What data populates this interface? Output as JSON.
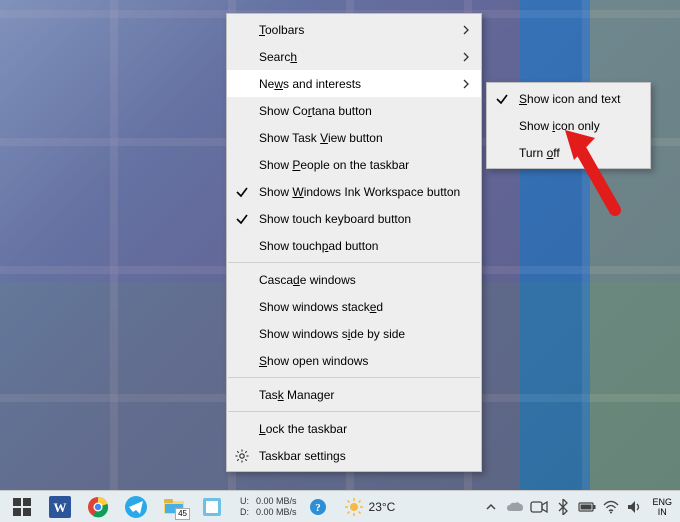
{
  "contextMenu": {
    "items": [
      {
        "label_html": "<span class='u'>T</span>oolbars",
        "submenu": true
      },
      {
        "label_html": "Searc<span class='u'>h</span>",
        "submenu": true
      },
      {
        "label_html": "Ne<span class='u'>w</span>s and interests",
        "submenu": true,
        "hovered": true
      },
      {
        "label_html": "Show Co<span class='u'>r</span>tana button"
      },
      {
        "label_html": "Show Task <span class='u'>V</span>iew button"
      },
      {
        "label_html": "Show <span class='u'>P</span>eople on the taskbar"
      },
      {
        "label_html": "Show <span class='u'>W</span>indows Ink Workspace button",
        "checked": true
      },
      {
        "label_html": "Show touch keyboard button",
        "checked": true
      },
      {
        "label_html": "Show touch<span class='u'>p</span>ad button"
      },
      {
        "separator": true
      },
      {
        "label_html": "Casca<span class='u'>d</span>e windows"
      },
      {
        "label_html": "Show windows stack<span class='u'>e</span>d"
      },
      {
        "label_html": "Show windows s<span class='u'>i</span>de by side"
      },
      {
        "label_html": "<span class='u'>S</span>how open windows"
      },
      {
        "separator": true
      },
      {
        "label_html": "Tas<span class='u'>k</span> Manager"
      },
      {
        "separator": true
      },
      {
        "label_html": "<span class='u'>L</span>ock the taskbar"
      },
      {
        "label_html": "Taskbar settin<span class='u'>g</span>s",
        "settingsIcon": true
      }
    ]
  },
  "submenu": {
    "items": [
      {
        "label_html": "<span class='u'>S</span>how icon and text",
        "checked": true
      },
      {
        "label_html": "Show <span class='u'>i</span>con only"
      },
      {
        "label_html": "Turn <span class='u'>o</span>ff"
      }
    ]
  },
  "taskbar": {
    "fileExplorerBadge": "45",
    "net": {
      "uploadLabel": "U:",
      "upload": "0.00 MB/s",
      "downloadLabel": "D:",
      "download": "0.00 MB/s"
    },
    "weather": {
      "temp": "23°C"
    },
    "lang1": "ENG",
    "lang2": "IN"
  }
}
